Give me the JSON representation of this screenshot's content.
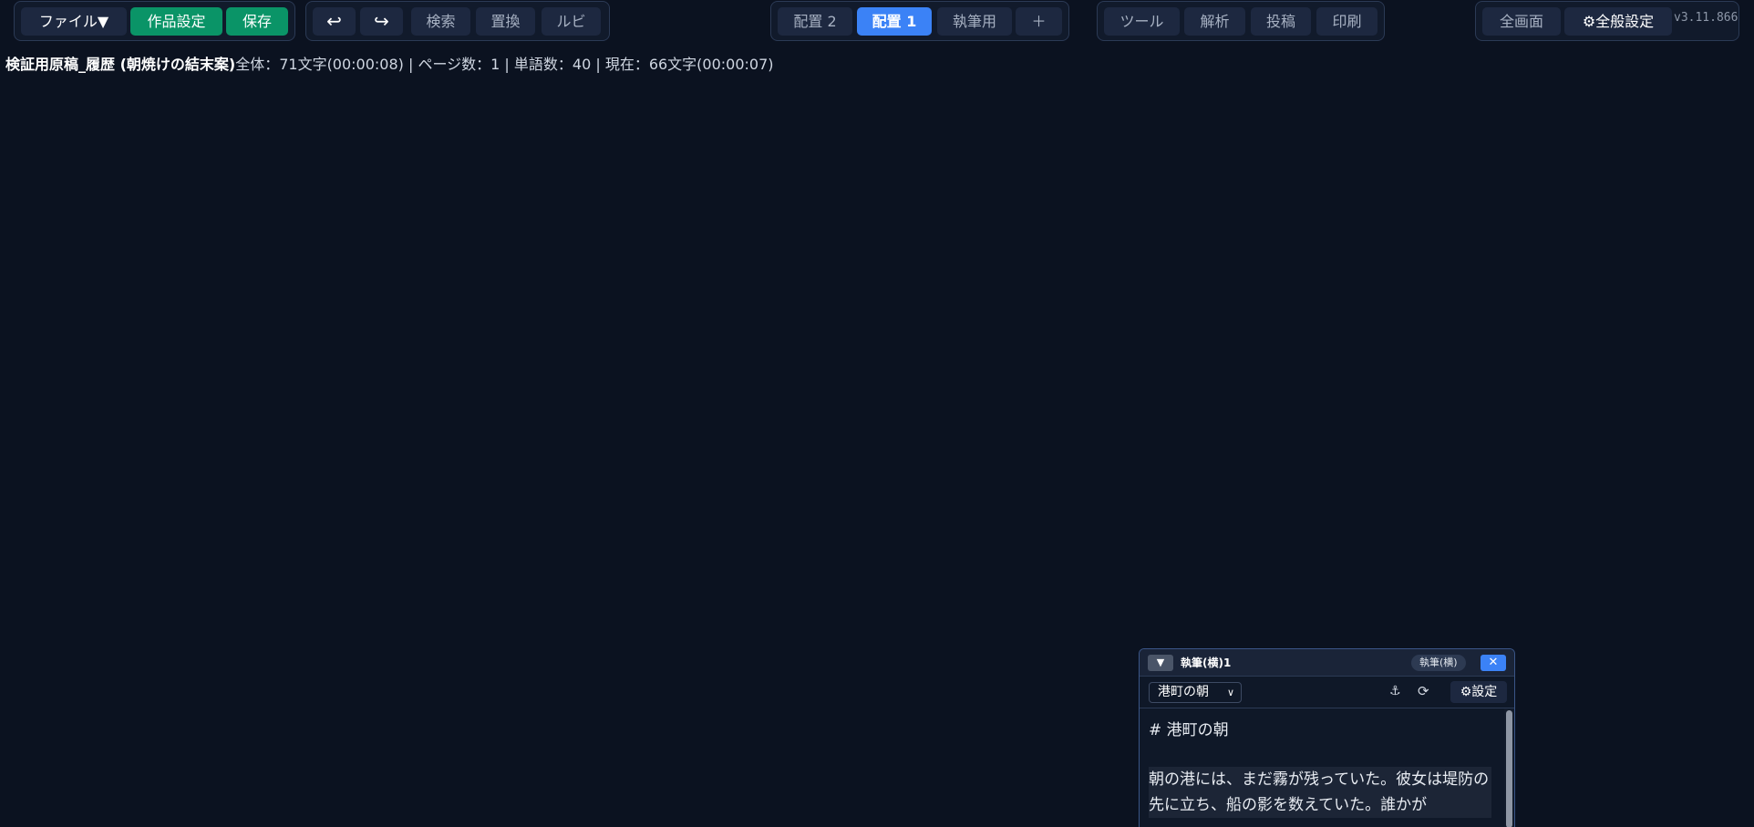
{
  "toolbar": {
    "file_menu": "ファイル▼",
    "work_settings": "作品設定",
    "save": "保存",
    "undo_icon": "↩",
    "redo_icon": "↪",
    "search": "検索",
    "replace": "置換",
    "ruby": "ルビ",
    "layouts": [
      {
        "label": "配置 2",
        "active": false
      },
      {
        "label": "配置 1",
        "active": true
      },
      {
        "label": "執筆用",
        "active": false
      }
    ],
    "add_layout": "＋",
    "tools": "ツール",
    "analysis": "解析",
    "post": "投稿",
    "print": "印刷",
    "fullscreen": "全画面",
    "general_settings": "⚙全般設定",
    "version": "v3.11.866"
  },
  "status": {
    "doc_title": "検証用原稿_履歴 (朝焼けの結末案)",
    "stats": "全体：71文字(00:00:08) | ページ数：1 | 単語数：40 | 現在：66文字(00:00:07)"
  },
  "panel": {
    "collapse_icon": "▼",
    "title": "執筆(横)1",
    "badge": "執筆(横)",
    "close_icon": "✕",
    "chapter": "港町の朝",
    "anchor_icon": "⚓",
    "refresh_icon": "⟳",
    "settings": "⚙設定",
    "heading": "# 港町の朝",
    "paragraph": "朝の港には、まだ霧が残っていた。彼女は堤防の先に立ち、船の影を数えていた。誰かが"
  },
  "colors": {
    "background": "#0b1220",
    "accent_green": "#0a9467",
    "accent_blue": "#3b82f6"
  }
}
